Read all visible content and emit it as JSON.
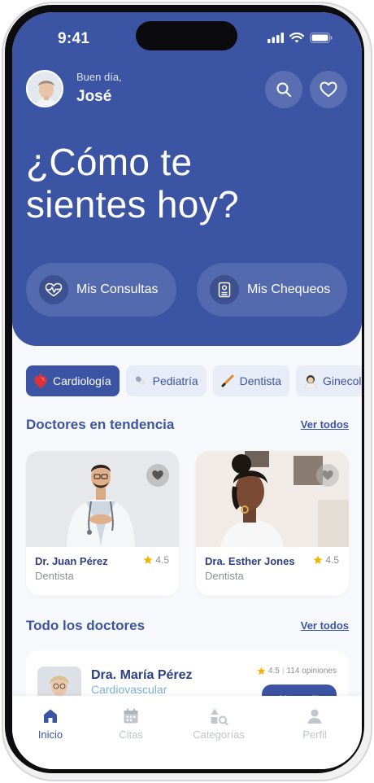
{
  "status_bar": {
    "time": "9:41"
  },
  "header": {
    "greeting": "Buen día,",
    "user_name": "José",
    "title_line1": "¿Cómo te",
    "title_line2": "sientes hoy?"
  },
  "quick_actions": [
    {
      "label": "Mis Consultas",
      "icon": "heartbeat-icon"
    },
    {
      "label": "Mis Chequeos",
      "icon": "clipboard-icon"
    }
  ],
  "categories": [
    {
      "label": "Cardiología",
      "icon": "heart-organ-icon",
      "active": true
    },
    {
      "label": "Pediatría",
      "icon": "pill-icon",
      "active": false
    },
    {
      "label": "Dentista",
      "icon": "pencil-icon",
      "active": false
    },
    {
      "label": "Ginecología",
      "icon": "doctor-woman-icon",
      "active": false
    }
  ],
  "trending": {
    "title": "Doctores en tendencia",
    "see_all": "Ver todos",
    "doctors": [
      {
        "name": "Dr. Juan Pérez",
        "specialty": "Dentista",
        "rating": "4.5"
      },
      {
        "name": "Dra. Esther Jones",
        "specialty": "Dentista",
        "rating": "4.5"
      }
    ]
  },
  "all_doctors": {
    "title": "Todo los doctores",
    "see_all": "Ver todos",
    "items": [
      {
        "name": "Dra. María Pérez",
        "specialty": "Cardiovascular",
        "rating": "4.5",
        "reviews": "114 opiniones",
        "button": "Ver perfil"
      }
    ]
  },
  "tabbar": [
    {
      "label": "Inicio",
      "icon": "home-icon",
      "active": true
    },
    {
      "label": "Citas",
      "icon": "calendar-icon",
      "active": false
    },
    {
      "label": "Categorías",
      "icon": "categories-icon",
      "active": false
    },
    {
      "label": "Perfil",
      "icon": "person-icon",
      "active": false
    }
  ],
  "colors": {
    "primary": "#3b54a3",
    "background": "#f7f8fb",
    "star": "#f5b301",
    "muted": "#8a8f99"
  }
}
